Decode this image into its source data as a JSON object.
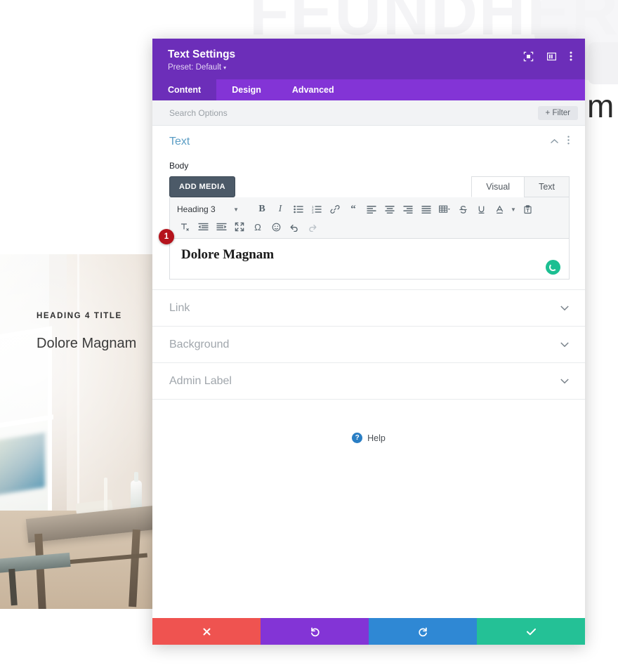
{
  "background": {
    "watermark_text": "FEUNDHER",
    "dark_word": "m",
    "card": {
      "kicker": "HEADING 4 TITLE",
      "headline": "Dolore Magnam"
    }
  },
  "modal": {
    "title": "Text Settings",
    "preset_label": "Preset: Default",
    "preset_caret": "▾",
    "header_icons": [
      {
        "name": "focus-icon",
        "glyph": "⊡"
      },
      {
        "name": "layout-columns-icon",
        "glyph": "▥"
      },
      {
        "name": "more-vertical-icon",
        "glyph": "⋮"
      }
    ],
    "tabs": [
      {
        "label": "Content",
        "active": true
      },
      {
        "label": "Design",
        "active": false
      },
      {
        "label": "Advanced",
        "active": false
      }
    ],
    "search": {
      "placeholder": "Search Options",
      "filter_label": "+ Filter"
    },
    "section": {
      "title": "Text",
      "collapse_glyph": "︿",
      "menu_glyph": "⋮",
      "field_label": "Body"
    },
    "editor": {
      "add_media_label": "ADD MEDIA",
      "mode_tabs": [
        {
          "label": "Visual",
          "active": true
        },
        {
          "label": "Text",
          "active": false
        }
      ],
      "format_select": "Heading 3",
      "toolbar_row1": [
        {
          "name": "bold-icon",
          "glyph": "B"
        },
        {
          "name": "italic-icon",
          "glyph": "I"
        },
        {
          "name": "bulleted-list-icon",
          "glyph": "☰"
        },
        {
          "name": "numbered-list-icon",
          "glyph": "☷"
        },
        {
          "name": "link-icon",
          "glyph": "🔗"
        },
        {
          "name": "blockquote-icon",
          "glyph": "❝"
        },
        {
          "name": "align-left-icon",
          "glyph": "≡"
        },
        {
          "name": "align-center-icon",
          "glyph": "≡"
        },
        {
          "name": "align-right-icon",
          "glyph": "≡"
        },
        {
          "name": "align-justify-icon",
          "glyph": "≡"
        },
        {
          "name": "table-icon",
          "glyph": "⊞"
        },
        {
          "name": "strikethrough-icon",
          "glyph": "S"
        },
        {
          "name": "underline-icon",
          "glyph": "U"
        },
        {
          "name": "text-color-icon",
          "glyph": "A"
        },
        {
          "name": "paste-as-text-icon",
          "glyph": "📋"
        }
      ],
      "toolbar_row2": [
        {
          "name": "clear-formatting-icon",
          "glyph": "Tx"
        },
        {
          "name": "outdent-icon",
          "glyph": "⇤"
        },
        {
          "name": "indent-icon",
          "glyph": "⇥"
        },
        {
          "name": "fullscreen-icon",
          "glyph": "⤢"
        },
        {
          "name": "special-character-icon",
          "glyph": "Ω"
        },
        {
          "name": "emoji-icon",
          "glyph": "☺"
        },
        {
          "name": "undo-icon",
          "glyph": "↶"
        },
        {
          "name": "redo-icon",
          "glyph": "↷"
        }
      ],
      "content_text": "Dolore Magnam",
      "badge_number": "1"
    },
    "accordions": [
      {
        "title": "Link",
        "chevron": "⌄"
      },
      {
        "title": "Background",
        "chevron": "⌄"
      },
      {
        "title": "Admin Label",
        "chevron": "⌄"
      }
    ],
    "help": {
      "icon_glyph": "?",
      "label": "Help"
    },
    "footer": [
      {
        "name": "cancel-button",
        "glyph": "✖",
        "class": "f-cancel"
      },
      {
        "name": "undo-button",
        "glyph": "↺",
        "class": "f-undo"
      },
      {
        "name": "redo-button",
        "glyph": "↻",
        "class": "f-redo"
      },
      {
        "name": "save-button",
        "glyph": "✔",
        "class": "f-save"
      }
    ]
  },
  "colors": {
    "header_purple": "#6c2eb9",
    "tab_purple": "#8334d6",
    "section_blue": "#5b9dc4",
    "badge_red": "#b5131c",
    "spinner_green": "#1cbf92",
    "cancel_red": "#ef5350",
    "redo_blue": "#2f88d4",
    "save_green": "#24c196"
  }
}
